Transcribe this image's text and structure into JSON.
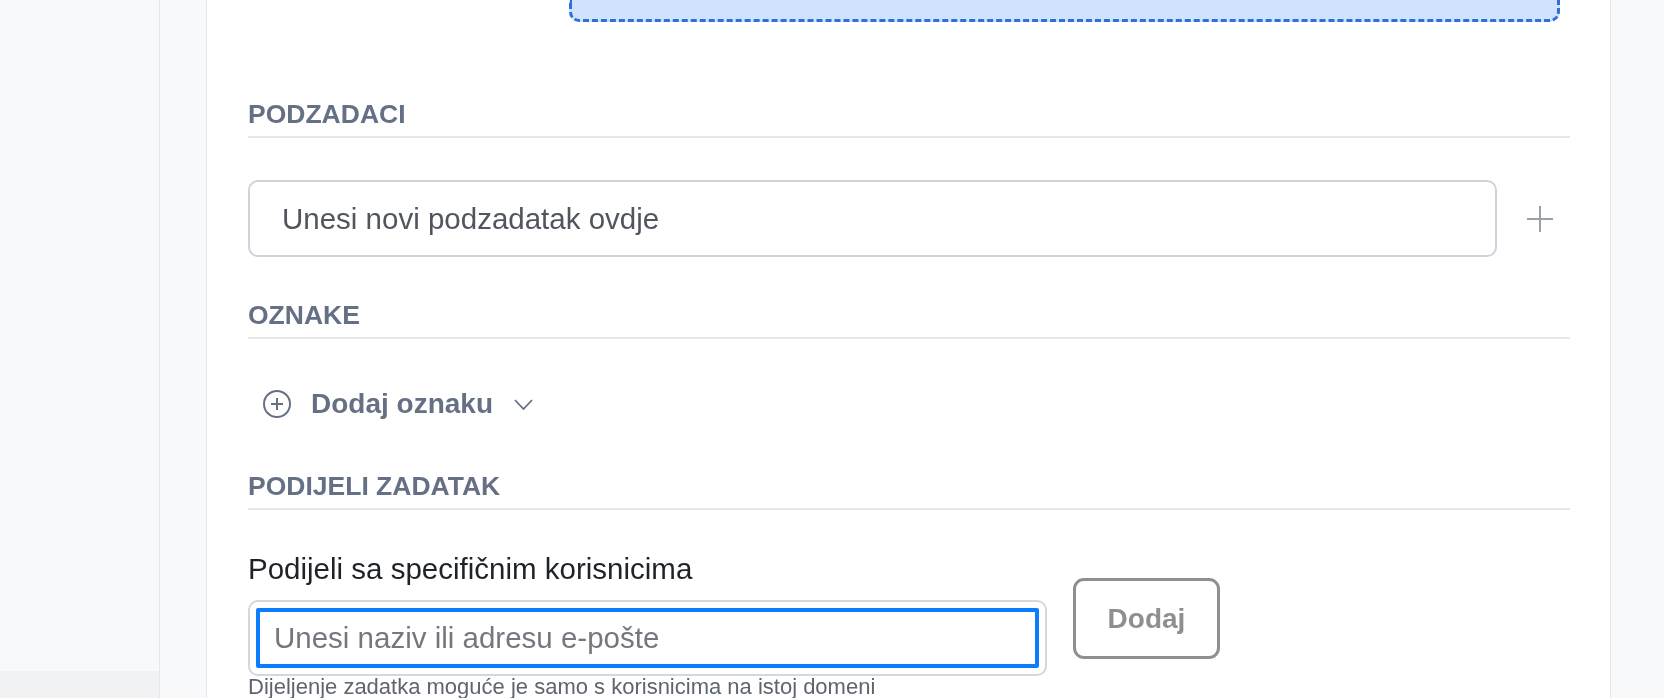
{
  "sections": [
    {
      "kind": "subtasks",
      "heading": "PODZADACI",
      "input": {
        "placeholder": "Unesi novi podzadatak ovdje"
      }
    },
    {
      "kind": "tags",
      "heading": "OZNAKE",
      "add_tag": {
        "label": "Dodaj oznaku"
      }
    },
    {
      "kind": "share",
      "heading": "PODIJELI ZADATAK",
      "label": "Podijeli sa specifičnim korisnicima",
      "input": {
        "placeholder": "Unesi naziv ili adresu e-pošte",
        "focused": true
      },
      "button": {
        "label": "Dodaj",
        "disabled": true
      },
      "hint": "Dijeljenje zadatka moguće je samo s korisnicima na istoj domeni"
    }
  ]
}
